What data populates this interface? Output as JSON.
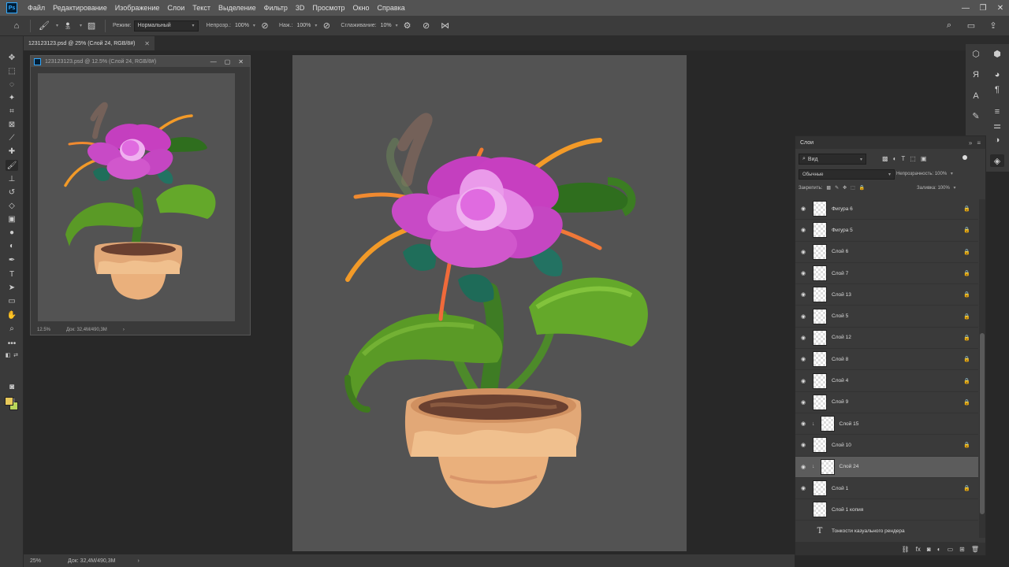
{
  "menu": {
    "items": [
      "Файл",
      "Редактирование",
      "Изображение",
      "Слои",
      "Текст",
      "Выделение",
      "Фильтр",
      "3D",
      "Просмотр",
      "Окно",
      "Справка"
    ]
  },
  "options": {
    "brush_size": "35",
    "mode_label": "Режим:",
    "mode_value": "Нормальный",
    "opacity_label": "Непрозр.:",
    "opacity_value": "100%",
    "pressure_label": "Наж.:",
    "pressure_value": "100%",
    "smoothing_label": "Сглаживание:",
    "smoothing_value": "10%"
  },
  "document": {
    "tab_title": "123123123.psd @ 25% (Слой 24, RGB/8#)",
    "zoom": "25%",
    "doc_size": "Док: 32,4M/490,3M"
  },
  "navigator_window": {
    "title": "123123123.psd @ 12.5% (Слой 24, RGB/8#)",
    "zoom": "12.5%",
    "doc_size": "Док: 32,4M/490,3M"
  },
  "layers_panel": {
    "title": "Слои",
    "filter_kind": "Вид",
    "blend_mode": "Обычные",
    "opacity_label": "Непрозрачность:",
    "opacity_value": "100%",
    "lock_label": "Закрепить:",
    "fill_label": "Заливка:",
    "fill_value": "100%",
    "layers": [
      {
        "name": "Фигура 6",
        "visible": true,
        "locked": true,
        "kind": "raster",
        "clipped": false,
        "selected": false
      },
      {
        "name": "Фигура 5",
        "visible": true,
        "locked": true,
        "kind": "raster",
        "clipped": false,
        "selected": false
      },
      {
        "name": "Слой 6",
        "visible": true,
        "locked": true,
        "kind": "raster",
        "clipped": false,
        "selected": false
      },
      {
        "name": "Слой 7",
        "visible": true,
        "locked": true,
        "kind": "raster",
        "clipped": false,
        "selected": false
      },
      {
        "name": "Слой 13",
        "visible": true,
        "locked": true,
        "kind": "raster",
        "clipped": false,
        "selected": false
      },
      {
        "name": "Слой 5",
        "visible": true,
        "locked": true,
        "kind": "raster",
        "clipped": false,
        "selected": false
      },
      {
        "name": "Слой 12",
        "visible": true,
        "locked": true,
        "kind": "raster",
        "clipped": false,
        "selected": false
      },
      {
        "name": "Слой 8",
        "visible": true,
        "locked": true,
        "kind": "raster",
        "clipped": false,
        "selected": false
      },
      {
        "name": "Слой 4",
        "visible": true,
        "locked": true,
        "kind": "raster",
        "clipped": false,
        "selected": false
      },
      {
        "name": "Слой 9",
        "visible": true,
        "locked": true,
        "kind": "raster",
        "clipped": false,
        "selected": false
      },
      {
        "name": "Слой 15",
        "visible": true,
        "locked": false,
        "kind": "raster",
        "clipped": true,
        "selected": false
      },
      {
        "name": "Слой 10",
        "visible": true,
        "locked": true,
        "kind": "raster",
        "clipped": false,
        "selected": false
      },
      {
        "name": "Слой 24",
        "visible": true,
        "locked": false,
        "kind": "raster",
        "clipped": true,
        "selected": true
      },
      {
        "name": "Слой 1",
        "visible": true,
        "locked": true,
        "kind": "raster",
        "clipped": false,
        "selected": false
      },
      {
        "name": "Слой 1 копия",
        "visible": false,
        "locked": false,
        "kind": "raster",
        "clipped": false,
        "selected": false
      },
      {
        "name": "Тонкости казуального рендера",
        "visible": false,
        "locked": false,
        "kind": "text",
        "clipped": false,
        "selected": false
      }
    ]
  },
  "colors": {
    "foreground": "#e8c95a",
    "background": "#b8d65a",
    "canvas_bg": "#535353"
  }
}
